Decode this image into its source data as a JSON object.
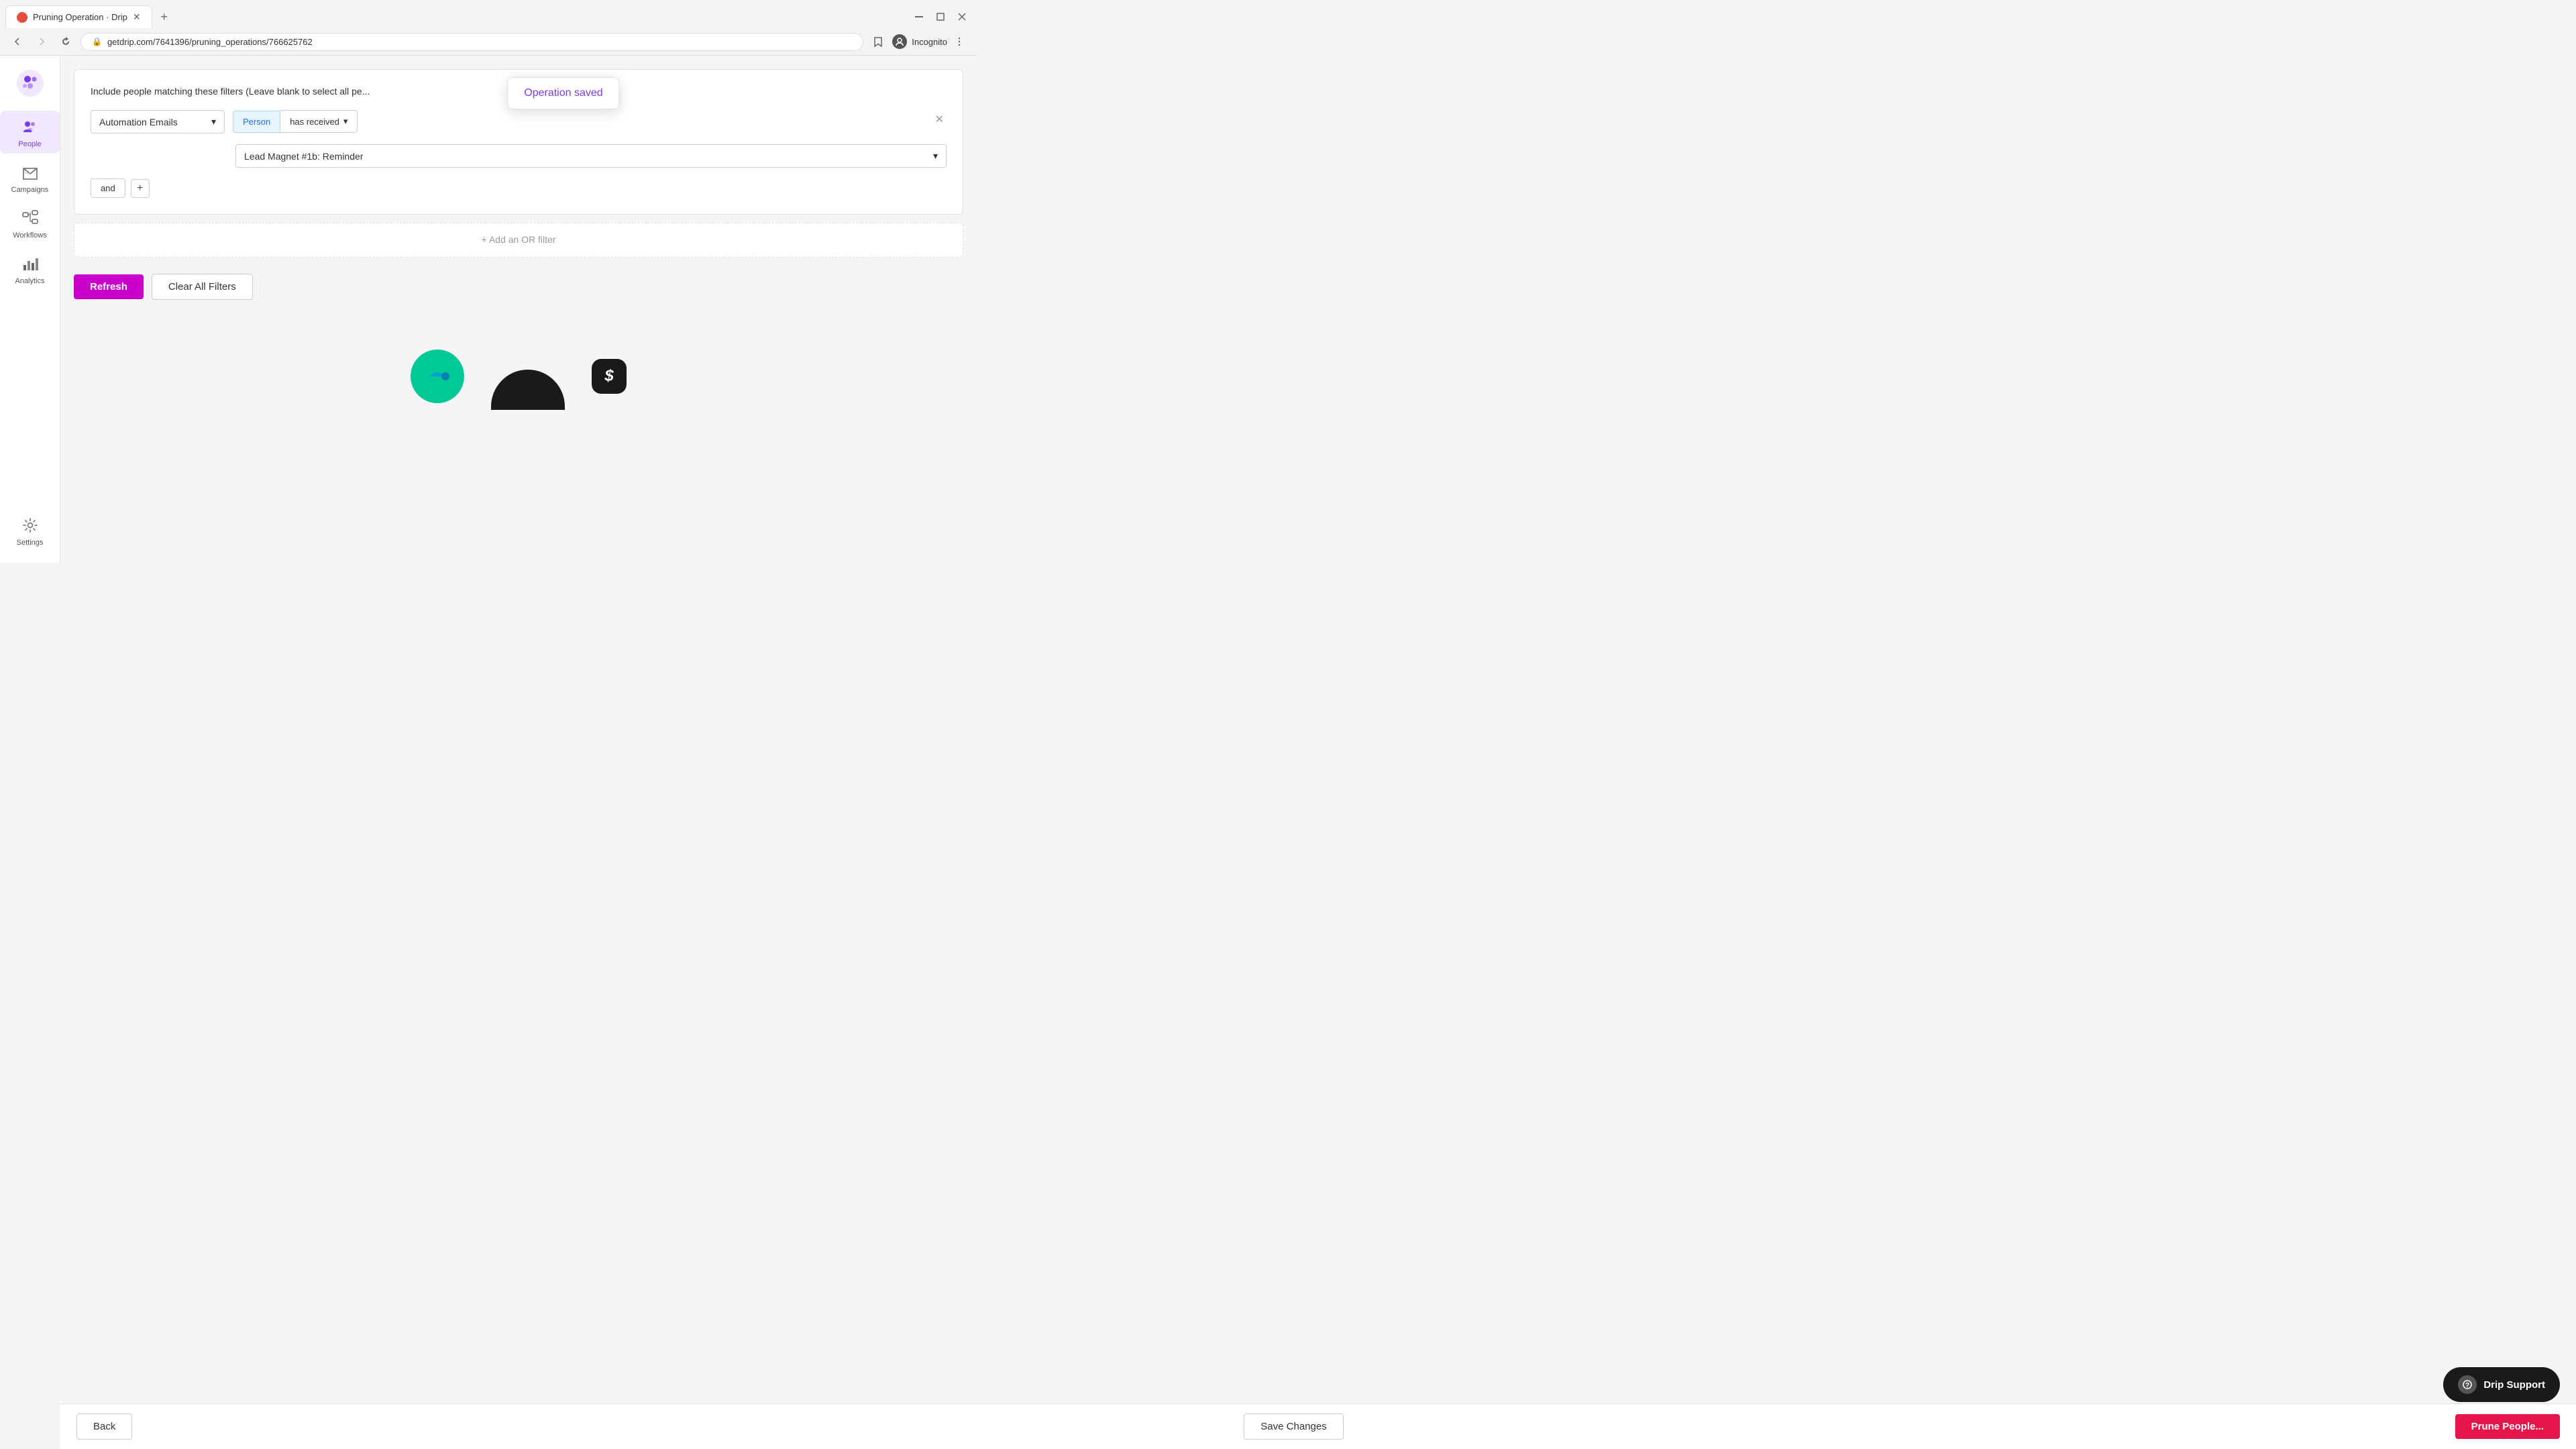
{
  "browser": {
    "tab_title": "Pruning Operation · Drip",
    "url": "getdrip.com/7641396/pruning_operations/766625762",
    "new_tab_label": "+",
    "incognito_label": "Incognito"
  },
  "sidebar": {
    "items": [
      {
        "id": "people",
        "label": "People",
        "active": true
      },
      {
        "id": "campaigns",
        "label": "Campaigns",
        "active": false
      },
      {
        "id": "workflows",
        "label": "Workflows",
        "active": false
      },
      {
        "id": "analytics",
        "label": "Analytics",
        "active": false
      },
      {
        "id": "settings",
        "label": "Settings",
        "active": false
      }
    ]
  },
  "page": {
    "include_text": "Include people matching these filters (Leave blank to select all pe...",
    "filter": {
      "type_label": "Automation Emails",
      "pill_person": "Person",
      "pill_action": "has received",
      "lead_magnet": "Lead Magnet #1b: Reminder",
      "and_label": "and",
      "plus_label": "+"
    },
    "or_filter_label": "+ Add an OR filter",
    "refresh_label": "Refresh",
    "clear_filters_label": "Clear All Filters"
  },
  "toast": {
    "message": "Operation saved"
  },
  "bottom_bar": {
    "back_label": "Back",
    "save_label": "Save Changes",
    "prune_label": "Prune People..."
  },
  "support": {
    "label": "Drip Support"
  }
}
